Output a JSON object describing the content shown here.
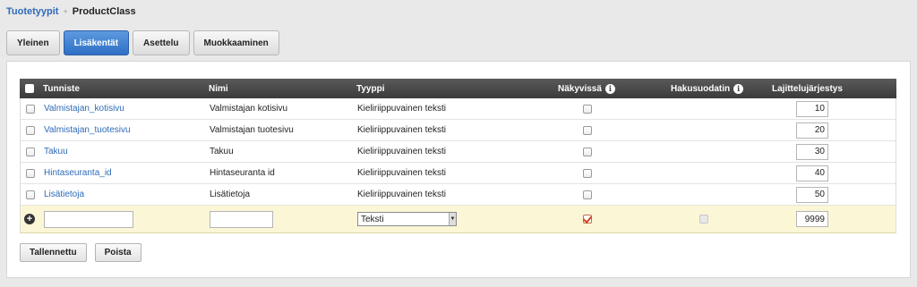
{
  "breadcrumb": {
    "parent": "Tuotetyypit",
    "separator": "+",
    "current": "ProductClass"
  },
  "tabs": [
    {
      "label": "Yleinen",
      "active": false
    },
    {
      "label": "Lisäkentät",
      "active": true
    },
    {
      "label": "Asettelu",
      "active": false
    },
    {
      "label": "Muokkaaminen",
      "active": false
    }
  ],
  "table": {
    "headers": {
      "tunniste": "Tunniste",
      "nimi": "Nimi",
      "tyyppi": "Tyyppi",
      "nakyvissa": "Näkyvissä",
      "hakusuodatin": "Hakusuodatin",
      "lajittelu": "Lajittelujärjestys",
      "info": "i"
    },
    "rows": [
      {
        "id": "Valmistajan_kotisivu",
        "name": "Valmistajan kotisivu",
        "type": "Kieliriippuvainen teksti",
        "order": "10"
      },
      {
        "id": "Valmistajan_tuotesivu",
        "name": "Valmistajan tuotesivu",
        "type": "Kieliriippuvainen teksti",
        "order": "20"
      },
      {
        "id": "Takuu",
        "name": "Takuu",
        "type": "Kieliriippuvainen teksti",
        "order": "30"
      },
      {
        "id": "Hintaseuranta_id",
        "name": "Hintaseuranta id",
        "type": "Kieliriippuvainen teksti",
        "order": "40"
      },
      {
        "id": "Lisätietoja",
        "name": "Lisätietoja",
        "type": "Kieliriippuvainen teksti",
        "order": "50"
      }
    ],
    "new_row": {
      "add_icon": "+",
      "id_value": "",
      "name_value": "",
      "type_selected": "Teksti",
      "visible_checked": true,
      "filter_checked": false,
      "order": "9999"
    }
  },
  "actions": {
    "save_label": "Tallennettu",
    "delete_label": "Poista"
  }
}
